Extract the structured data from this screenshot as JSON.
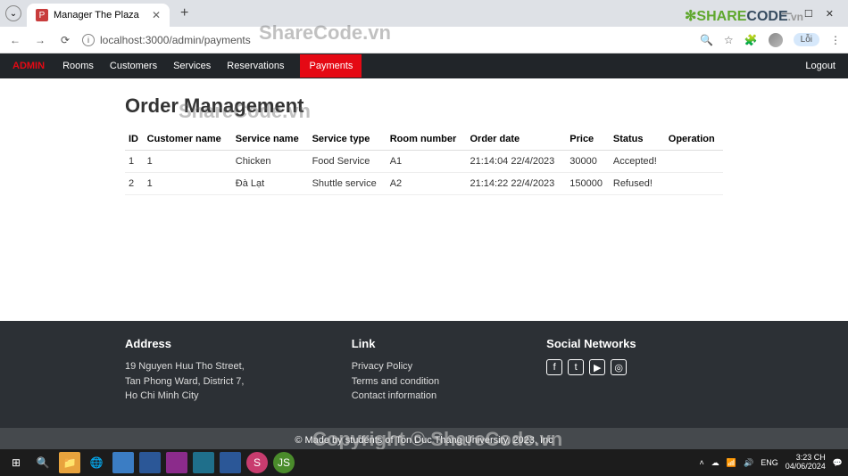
{
  "browser": {
    "tab_title": "Manager The Plaza",
    "url": "localhost:3000/admin/payments",
    "extension_label": "Lỗi"
  },
  "window": {
    "min": "—",
    "max": "☐",
    "close": "✕"
  },
  "nav": {
    "brand": "ADMIN",
    "items": [
      "Rooms",
      "Customers",
      "Services",
      "Reservations",
      "Payments"
    ],
    "logout": "Logout"
  },
  "page": {
    "title": "Order Management",
    "headers": [
      "ID",
      "Customer name",
      "Service name",
      "Service type",
      "Room number",
      "Order date",
      "Price",
      "Status",
      "Operation"
    ],
    "rows": [
      {
        "id": "1",
        "customer": "1",
        "service": "Chicken",
        "type": "Food Service",
        "room": "A1",
        "date": "21:14:04 22/4/2023",
        "price": "30000",
        "status": "Accepted!",
        "op": ""
      },
      {
        "id": "2",
        "customer": "1",
        "service": "Đà Lạt",
        "type": "Shuttle service",
        "room": "A2",
        "date": "21:14:22 22/4/2023",
        "price": "150000",
        "status": "Refused!",
        "op": ""
      }
    ]
  },
  "footer": {
    "address_title": "Address",
    "address_l1": "19 Nguyen Huu Tho Street,",
    "address_l2": "Tan Phong Ward, District 7,",
    "address_l3": "Ho Chi Minh City",
    "link_title": "Link",
    "links": [
      "Privacy Policy",
      "Terms and condition",
      "Contact information"
    ],
    "social_title": "Social Networks",
    "copyright": "© Made by students of Ton Duc Thang University, 2023, Inc"
  },
  "watermark": {
    "top": "ShareCode.vn",
    "mid": "ShareCode.vn",
    "bottom": "Copyright © ShareCode.vn",
    "logo_share": "SHARE",
    "logo_code": "CODE",
    "logo_vn": ".vn"
  },
  "taskbar": {
    "lang": "ENG",
    "time": "3:23 CH",
    "date": "04/06/2024"
  }
}
